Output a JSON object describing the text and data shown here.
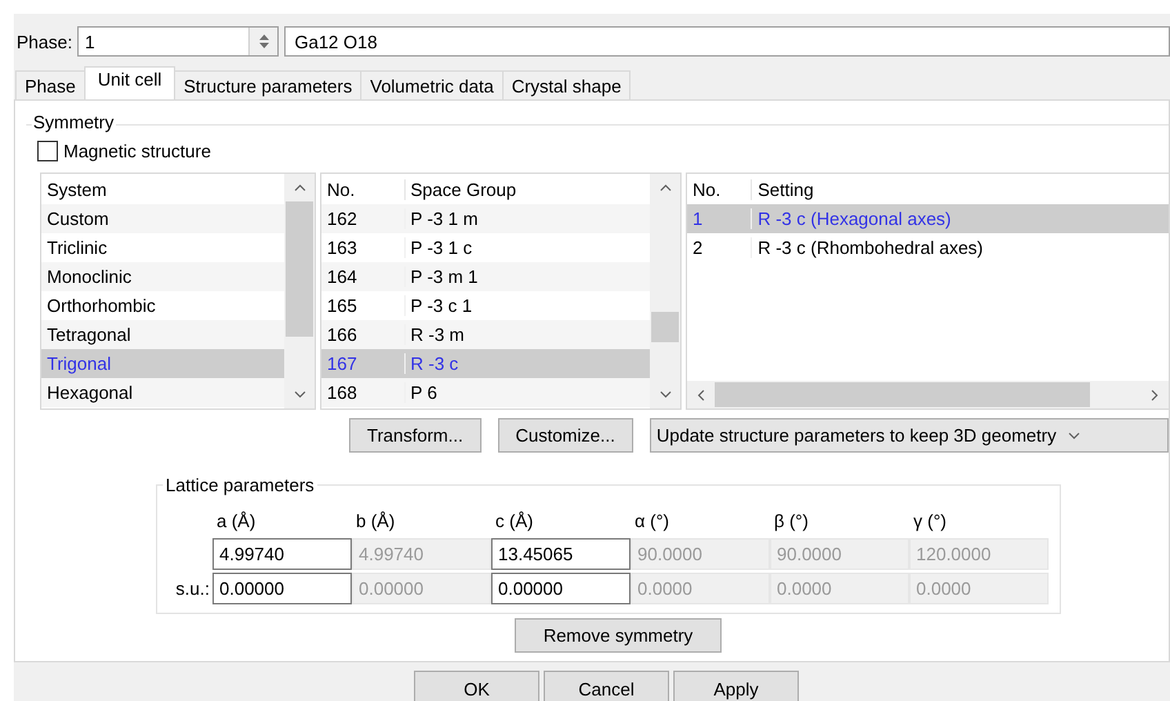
{
  "phase_selector": {
    "label": "Phase:",
    "value": "1",
    "name": "Ga12 O18"
  },
  "tabs": [
    {
      "label": "Phase",
      "selected": false
    },
    {
      "label": "Unit cell",
      "selected": true
    },
    {
      "label": "Structure parameters",
      "selected": false
    },
    {
      "label": "Volumetric data",
      "selected": false
    },
    {
      "label": "Crystal shape",
      "selected": false
    }
  ],
  "symmetry": {
    "title": "Symmetry",
    "magnetic_structure": {
      "label": "Magnetic structure",
      "checked": false
    },
    "system_list": {
      "columns": [
        "System"
      ],
      "rows": [
        {
          "cells": [
            "Custom"
          ],
          "selected": false
        },
        {
          "cells": [
            "Triclinic"
          ],
          "selected": false
        },
        {
          "cells": [
            "Monoclinic"
          ],
          "selected": false
        },
        {
          "cells": [
            "Orthorhombic"
          ],
          "selected": false
        },
        {
          "cells": [
            "Tetragonal"
          ],
          "selected": false
        },
        {
          "cells": [
            "Trigonal"
          ],
          "selected": true
        },
        {
          "cells": [
            "Hexagonal"
          ],
          "selected": false
        }
      ]
    },
    "space_group_list": {
      "columns": [
        "No.",
        "Space Group"
      ],
      "rows": [
        {
          "cells": [
            "162",
            "P -3 1 m"
          ],
          "selected": false
        },
        {
          "cells": [
            "163",
            "P -3 1 c"
          ],
          "selected": false
        },
        {
          "cells": [
            "164",
            "P -3 m 1"
          ],
          "selected": false
        },
        {
          "cells": [
            "165",
            "P -3 c 1"
          ],
          "selected": false
        },
        {
          "cells": [
            "166",
            "R -3 m"
          ],
          "selected": false
        },
        {
          "cells": [
            "167",
            "R -3 c"
          ],
          "selected": true
        },
        {
          "cells": [
            "168",
            "P 6"
          ],
          "selected": false
        }
      ]
    },
    "setting_list": {
      "columns": [
        "No.",
        "Setting"
      ],
      "rows": [
        {
          "cells": [
            "1",
            "R -3 c (Hexagonal axes)"
          ],
          "selected": true
        },
        {
          "cells": [
            "2",
            "R -3 c (Rhombohedral axes)"
          ],
          "selected": false
        }
      ]
    },
    "buttons": [
      "Transform...",
      "Customize..."
    ],
    "update_mode": "Update structure parameters to keep 3D geometry"
  },
  "lattice_parameters": {
    "title": "Lattice parameters",
    "columns": [
      {
        "label": "a (Å)",
        "editable": true
      },
      {
        "label": "b (Å)",
        "editable": false
      },
      {
        "label": "c (Å)",
        "editable": true
      },
      {
        "label": "α (°)",
        "editable": false
      },
      {
        "label": "β (°)",
        "editable": false
      },
      {
        "label": "γ (°)",
        "editable": false
      }
    ],
    "rows": [
      {
        "values": [
          "4.99740",
          "4.99740",
          "13.45065",
          "90.0000",
          "90.0000",
          "120.0000"
        ]
      },
      {
        "label": "s.u.:",
        "values": [
          "0.00000",
          "0.00000",
          "0.00000",
          "0.0000",
          "0.0000",
          "0.0000"
        ]
      }
    ]
  },
  "remove_symmetry_button": "Remove symmetry",
  "dialog_buttons": [
    "OK",
    "Cancel",
    "Apply"
  ]
}
